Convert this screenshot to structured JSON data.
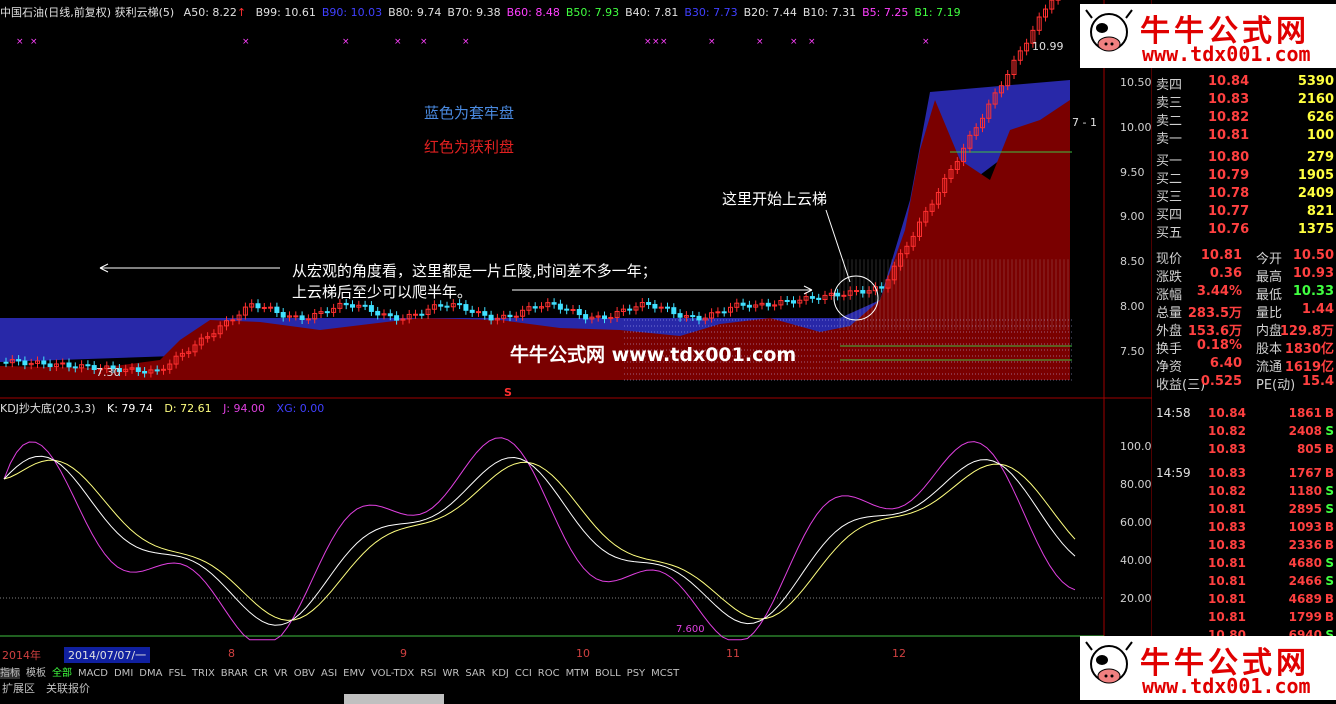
{
  "header": {
    "title": "中国石油(日线,前复权) 获利云梯(5)",
    "a50": "A50: 8.22",
    "items": [
      {
        "text": "B99: 10.61",
        "color": "#e0e0e0"
      },
      {
        "text": "B90: 10.03",
        "color": "#4040ff"
      },
      {
        "text": "B80: 9.74",
        "color": "#e0e0e0"
      },
      {
        "text": "B70: 9.38",
        "color": "#e0e0e0"
      },
      {
        "text": "B60: 8.48",
        "color": "#ff40ff"
      },
      {
        "text": "B50: 7.93",
        "color": "#40ff40"
      },
      {
        "text": "B40: 7.81",
        "color": "#e0e0e0"
      },
      {
        "text": "B30: 7.73",
        "color": "#4040ff"
      },
      {
        "text": "B20: 7.44",
        "color": "#e0e0e0"
      },
      {
        "text": "B10: 7.31",
        "color": "#e0e0e0"
      },
      {
        "text": "B5: 7.25",
        "color": "#ff40ff"
      },
      {
        "text": "B1: 7.19",
        "color": "#40ff40"
      }
    ]
  },
  "annotations": {
    "blue_note": "蓝色为套牢盘",
    "red_note": "红色为获利盘",
    "ladder_note": "这里开始上云梯",
    "macro_line1": "从宏观的角度看，这里都是一片丘陵,时间差不多一年；",
    "macro_line2": "上云梯后至少可以爬半年。",
    "watermark": "牛牛公式网 www.tdx001.com",
    "high_label": "10.99",
    "low_label": "7.30",
    "right_label": "7 - 1",
    "kdj_signal_label": "7.600",
    "s_marker": "S"
  },
  "price_axis": [
    "10.50",
    "10.00",
    "9.50",
    "9.00",
    "8.50",
    "8.00",
    "7.50"
  ],
  "kdj_axis": [
    "100.0",
    "80.00",
    "60.00",
    "40.00",
    "20.00"
  ],
  "kdj_header": {
    "name": "KDJ抄大底(20,3,3)",
    "k": "K: 79.74",
    "d": "D: 72.61",
    "j": "J: 94.00",
    "xg": "XG: 0.00"
  },
  "x_axis": {
    "year": "2014年",
    "date": "2014/07/07/一",
    "months": [
      "8",
      "9",
      "10",
      "11",
      "12"
    ]
  },
  "tabs": [
    "指标",
    "模板",
    "全部",
    "MACD",
    "DMI",
    "DMA",
    "FSL",
    "TRIX",
    "BRAR",
    "CR",
    "VR",
    "OBV",
    "ASI",
    "EMV",
    "VOL-TDX",
    "RSI",
    "WR",
    "SAR",
    "KDJ",
    "CCI",
    "ROC",
    "MTM",
    "BOLL",
    "PSY",
    "MCST"
  ],
  "status": {
    "expand": "扩展区",
    "related": "关联报价"
  },
  "order_book": {
    "sell": [
      {
        "label": "卖四",
        "price": "10.84",
        "vol": "5390"
      },
      {
        "label": "卖三",
        "price": "10.83",
        "vol": "2160"
      },
      {
        "label": "卖二",
        "price": "10.82",
        "vol": "626"
      },
      {
        "label": "卖一",
        "price": "10.81",
        "vol": "100"
      }
    ],
    "buy": [
      {
        "label": "买一",
        "price": "10.80",
        "vol": "279"
      },
      {
        "label": "买二",
        "price": "10.79",
        "vol": "1905"
      },
      {
        "label": "买三",
        "price": "10.78",
        "vol": "2409"
      },
      {
        "label": "买四",
        "price": "10.77",
        "vol": "821"
      },
      {
        "label": "买五",
        "price": "10.76",
        "vol": "1375"
      }
    ]
  },
  "quote": [
    {
      "l1": "现价",
      "v1": "10.81",
      "l2": "今开",
      "v2": "10.50"
    },
    {
      "l1": "涨跌",
      "v1": "0.36",
      "l2": "最高",
      "v2": "10.93"
    },
    {
      "l1": "涨幅",
      "v1": "3.44%",
      "l2": "最低",
      "v2": "10.33"
    },
    {
      "l1": "总量",
      "v1": "283.5万",
      "l2": "量比",
      "v2": "1.44"
    },
    {
      "l1": "外盘",
      "v1": "153.6万",
      "l2": "内盘",
      "v2": "129.8万"
    },
    {
      "l1": "换手",
      "v1": "0.18%",
      "l2": "股本",
      "v2": "1830亿"
    },
    {
      "l1": "净资",
      "v1": "6.40",
      "l2": "流通",
      "v2": "1619亿"
    },
    {
      "l1": "收益(三)",
      "v1": "0.525",
      "l2": "PE(动)",
      "v2": "15.4"
    }
  ],
  "ticks": [
    {
      "time": "14:58",
      "price": "10.84",
      "vol": "1861",
      "side": "B"
    },
    {
      "time": "",
      "price": "10.82",
      "vol": "2408",
      "side": "S"
    },
    {
      "time": "",
      "price": "10.83",
      "vol": "805",
      "side": "B"
    },
    {
      "time": "14:59",
      "price": "10.83",
      "vol": "1767",
      "side": "B"
    },
    {
      "time": "",
      "price": "10.82",
      "vol": "1180",
      "side": "S"
    },
    {
      "time": "",
      "price": "10.81",
      "vol": "2895",
      "side": "S"
    },
    {
      "time": "",
      "price": "10.83",
      "vol": "1093",
      "side": "B"
    },
    {
      "time": "",
      "price": "10.83",
      "vol": "2336",
      "side": "B"
    },
    {
      "time": "",
      "price": "10.81",
      "vol": "4680",
      "side": "S"
    },
    {
      "time": "",
      "price": "10.81",
      "vol": "2466",
      "side": "S"
    },
    {
      "time": "",
      "price": "10.81",
      "vol": "4689",
      "side": "B"
    },
    {
      "time": "",
      "price": "10.81",
      "vol": "1799",
      "side": "B"
    },
    {
      "time": "",
      "price": "10.80",
      "vol": "6940",
      "side": "S"
    }
  ],
  "logo": {
    "name": "牛牛公式网",
    "url": "www.tdx001.com"
  },
  "colors": {
    "up": "#ff3030",
    "down": "#40e0ff",
    "blue_cloud": "#2828a8",
    "red_cloud": "#7a0000",
    "k": "#ffffff",
    "d": "#ffff80",
    "j": "#e040e0"
  }
}
